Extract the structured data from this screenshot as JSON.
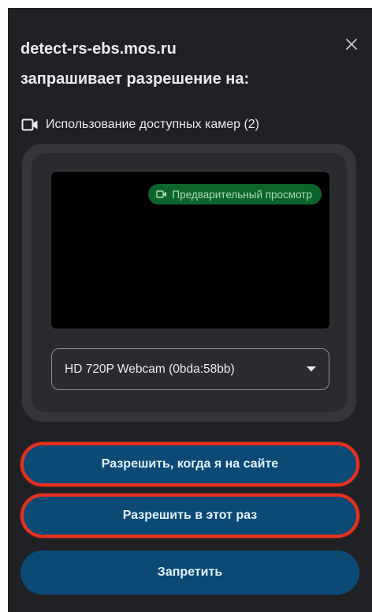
{
  "dialog": {
    "site": "detect-rs-ebs.mos.ru",
    "subtitle": "запрашивает разрешение на:",
    "permission": {
      "icon": "videocam-icon",
      "text": "Использование доступных камер (2)"
    },
    "preview": {
      "badge_label": "Предварительный просмотр",
      "badge_icon": "videocam-icon"
    },
    "camera_select": {
      "value": "HD 720P Webcam (0bda:58bb)"
    },
    "buttons": {
      "allow_on_site": "Разрешить, когда я на сайте",
      "allow_once": "Разрешить в этот раз",
      "deny": "Запретить"
    }
  },
  "colors": {
    "background": "#202124",
    "button": "#0b4a74",
    "highlight_ring": "#e8301f",
    "badge": "#0d652d"
  }
}
